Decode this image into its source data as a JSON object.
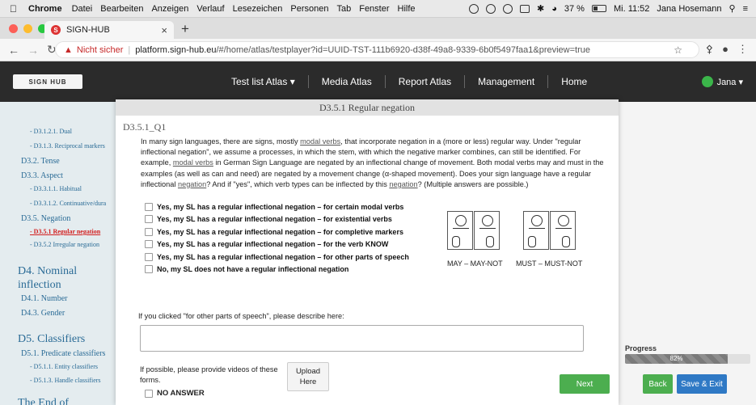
{
  "mac_menubar": {
    "app": "Chrome",
    "items": [
      "Datei",
      "Bearbeiten",
      "Anzeigen",
      "Verlauf",
      "Lesezeichen",
      "Personen",
      "Tab",
      "Fenster",
      "Hilfe"
    ],
    "battery": "37 %",
    "clock": "Mi. 11:52",
    "user": "Jana Hosemann"
  },
  "browser": {
    "tab_title": "SIGN-HUB",
    "security_label": "Nicht sicher",
    "url_host": "platform.sign-hub.eu",
    "url_path": "/#/home/atlas/testplayer?id=UUID-TST-111b6920-d38f-49a8-9339-6b0f5497faa1&preview=true"
  },
  "site_nav": {
    "logo": "SIGN HUB",
    "links": [
      "Test list Atlas ▾",
      "Media Atlas",
      "Report Atlas",
      "Management",
      "Home"
    ],
    "user": "Jana ▾"
  },
  "sidebar": {
    "items": [
      {
        "label": "- D3.1.2.1. Dual",
        "level": 3
      },
      {
        "label": "- D3.1.3. Reciprocal markers",
        "level": 3
      },
      {
        "label": "D3.2. Tense",
        "level": 2
      },
      {
        "label": "D3.3. Aspect",
        "level": 2
      },
      {
        "label": "- D3.3.1.1. Habitual",
        "level": 3
      },
      {
        "label": "- D3.3.1.2. Continuative/dura",
        "level": 3
      },
      {
        "label": "D3.5. Negation",
        "level": 2
      },
      {
        "label": "- D3.5.1 Regular negation",
        "level": 3,
        "active": true
      },
      {
        "label": "- D3.5.2 Irregular negation",
        "level": 3
      },
      {
        "label": "D4. Nominal inflection",
        "level": 1
      },
      {
        "label": "D4.1. Number",
        "level": 2
      },
      {
        "label": "D4.3. Gender",
        "level": 2
      },
      {
        "label": "D5. Classifiers",
        "level": 1
      },
      {
        "label": "D5.1. Predicate classifiers",
        "level": 2
      },
      {
        "label": "- D5.1.1. Entity classifiers",
        "level": 3
      },
      {
        "label": "- D5.1.3. Handle classifiers",
        "level": 3
      },
      {
        "label": "The End of",
        "level": 1
      }
    ]
  },
  "modal": {
    "title": "D3.5.1 Regular negation",
    "question_id": "D3.5.1_Q1",
    "text_parts": [
      "In many sign languages, there are signs, mostly ",
      "modal verbs",
      ", that incorporate negation in a (more or less) regular way. Under \"regular inflectional negation\", we assume a processes, in which the stem, with which the negative marker combines, can still be identified. For example, ",
      "modal verbs",
      " in German Sign Language are negated by an inflectional change of movement. Both modal verbs may and must in the examples (as well as can and need) are negated by a movement change (α-shaped movement). Does your sign language have a regular inflectional ",
      "negation",
      "? And if \"yes\", which verb types can be inflected by this ",
      "negation",
      "? (Multiple answers are possible.)"
    ],
    "options": [
      "Yes, my SL has a regular inflectional negation – for certain modal verbs",
      "Yes, my SL has a regular inflectional negation – for existential verbs",
      "Yes, my SL has a regular inflectional negation – for completive markers",
      "Yes, my SL has a regular inflectional negation – for the verb KNOW",
      "Yes, my SL has a regular inflectional negation – for other parts of speech",
      "No, my SL does not have a regular inflectional negation"
    ],
    "caption_left": "MAY – MAY-NOT",
    "caption_right": "MUST – MUST-NOT",
    "describe_label": "If you clicked \"for other parts of speech\", please describe here:",
    "describe_value": "",
    "video_label": "If possible, please provide videos of these forms.",
    "upload_label": "Upload Here",
    "no_answer_label": "NO ANSWER",
    "next_label": "Next"
  },
  "right_panel": {
    "progress_label": "Progress",
    "progress_percent": 82,
    "progress_text": "82%",
    "back_label": "Back",
    "save_exit_label": "Save & Exit"
  },
  "colors": {
    "next_green": "#4cae4f",
    "save_blue": "#2f79c5",
    "sidebar_bg": "#e4ecef",
    "sidebar_link": "#2a6b96",
    "active_red": "#d32020",
    "navbar_bg": "#2b2b2b"
  }
}
